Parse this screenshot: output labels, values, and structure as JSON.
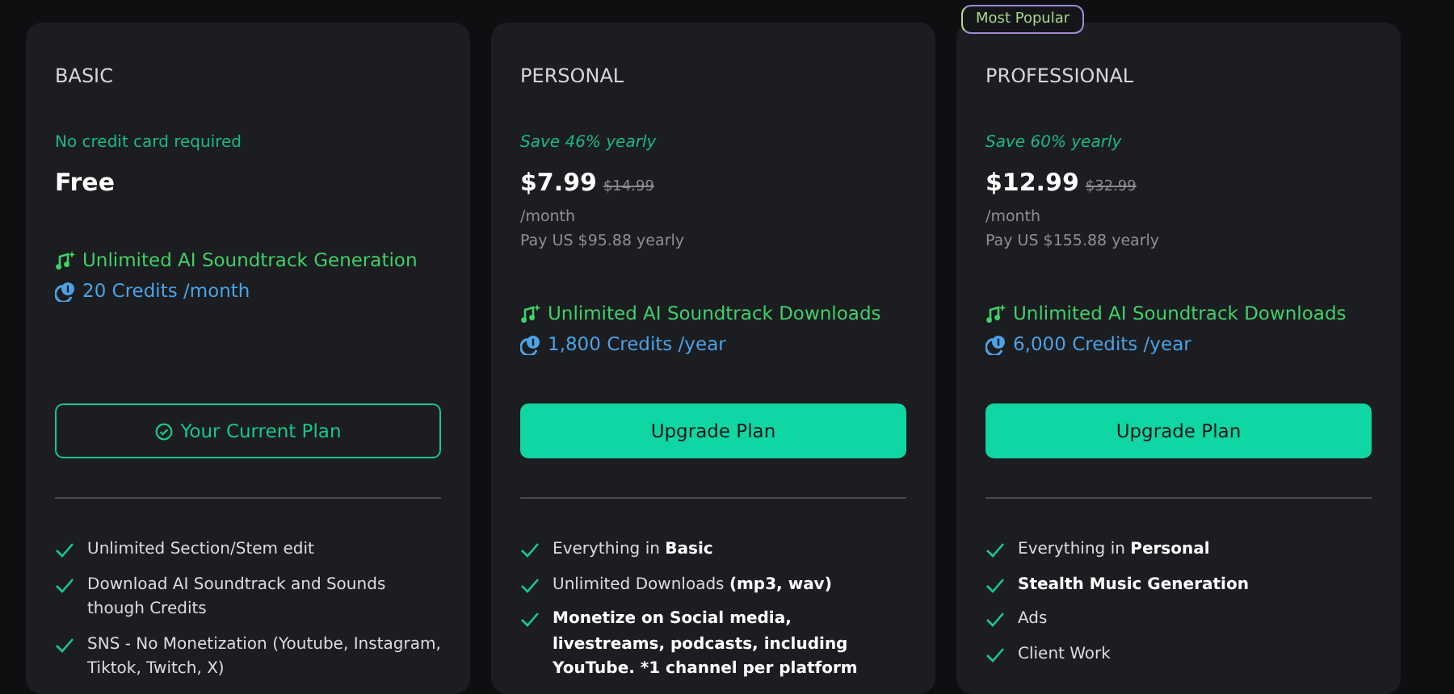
{
  "plans": [
    {
      "name": "BASIC",
      "tagline": {
        "kind": "note",
        "text": "No credit card required"
      },
      "price": "Free",
      "highlights": [
        {
          "kind": "music",
          "text": "Unlimited AI Soundtrack Generation"
        },
        {
          "kind": "credits",
          "text": "20 Credits /month"
        }
      ],
      "button": {
        "label": "Your Current Plan",
        "current": true
      },
      "features": [
        "Unlimited Section/Stem edit",
        "Download AI Soundtrack and Sounds though Credits",
        "SNS - No Monetization (Youtube, Instagram, Tiktok, Twitch, X)"
      ]
    },
    {
      "name": "PERSONAL",
      "tagline": {
        "kind": "save",
        "text": "Save 46% yearly"
      },
      "price": "$7.99",
      "original_price": "$14.99",
      "period": "/month",
      "billing": "Pay US $95.88 yearly",
      "highlights": [
        {
          "kind": "music",
          "text": "Unlimited AI Soundtrack Downloads"
        },
        {
          "kind": "credits",
          "text": "1,800 Credits /year"
        }
      ],
      "button": {
        "label": "Upgrade Plan",
        "current": false
      },
      "features": [
        "Everything in **Basic**",
        "Unlimited Downloads **(mp3, wav)**",
        "**Monetize on Social media, livestreams, podcasts, including YouTube. *1 channel per platform**"
      ]
    },
    {
      "name": "PROFESSIONAL",
      "badge": "Most Popular",
      "tagline": {
        "kind": "save",
        "text": "Save 60% yearly"
      },
      "price": "$12.99",
      "original_price": "$32.99",
      "period": "/month",
      "billing": "Pay US $155.88 yearly",
      "highlights": [
        {
          "kind": "music",
          "text": "Unlimited AI Soundtrack Downloads"
        },
        {
          "kind": "credits",
          "text": "6,000 Credits /year"
        }
      ],
      "button": {
        "label": "Upgrade Plan",
        "current": false
      },
      "features": [
        "Everything in **Personal**",
        "**Stealth Music Generation**",
        "Ads",
        "Client Work"
      ]
    }
  ]
}
